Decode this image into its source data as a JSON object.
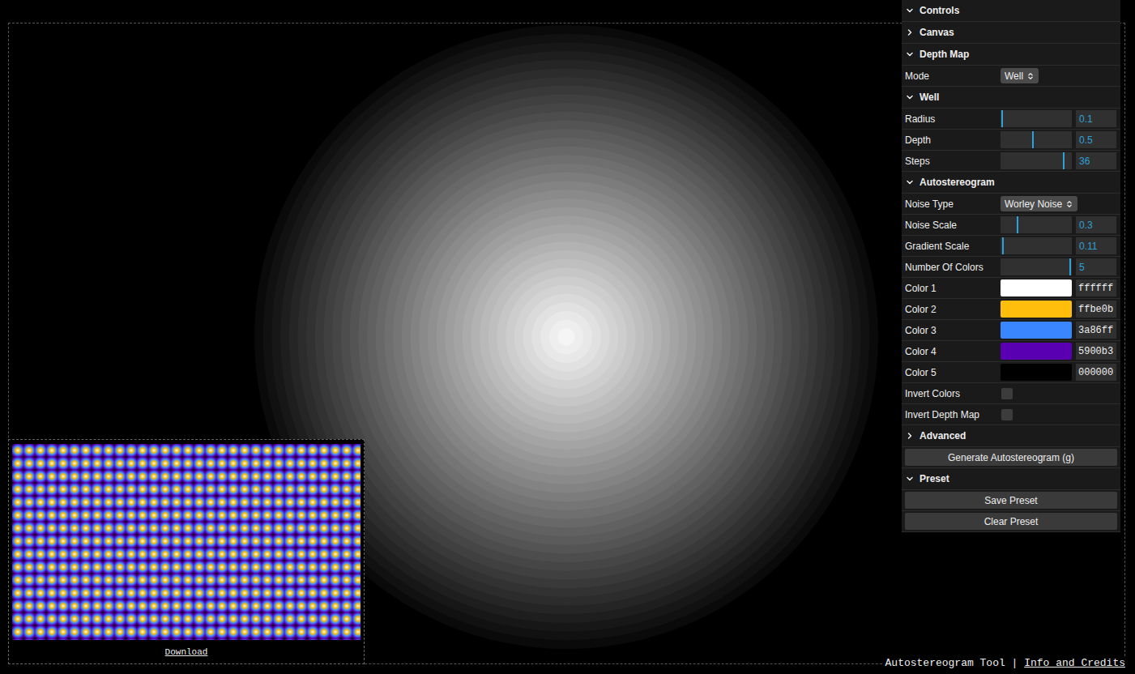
{
  "panel": {
    "title": "Controls",
    "expanded": true,
    "sections": [
      {
        "title": "Canvas",
        "expanded": false,
        "rows": []
      },
      {
        "title": "Depth Map",
        "expanded": true,
        "rows": [
          {
            "kind": "select",
            "label": "Mode",
            "value": "Well"
          }
        ]
      },
      {
        "title": "Well",
        "expanded": true,
        "rows": [
          {
            "kind": "slider",
            "label": "Radius",
            "value": "0.1",
            "level": 0.01
          },
          {
            "kind": "slider",
            "label": "Depth",
            "value": "0.5",
            "level": 0.45
          },
          {
            "kind": "slider",
            "label": "Steps",
            "value": "36",
            "level": 0.9
          }
        ]
      },
      {
        "title": "Autostereogram",
        "expanded": true,
        "rows": [
          {
            "kind": "select",
            "label": "Noise Type",
            "value": "Worley Noise"
          },
          {
            "kind": "slider",
            "label": "Noise Scale",
            "value": "0.3",
            "level": 0.23
          },
          {
            "kind": "slider",
            "label": "Gradient Scale",
            "value": "0.11",
            "level": 0.02
          },
          {
            "kind": "slider",
            "label": "Number Of Colors",
            "value": "5",
            "level": 0.99
          },
          {
            "kind": "color",
            "label": "Color 1",
            "value": "ffffff",
            "color": "#ffffff"
          },
          {
            "kind": "color",
            "label": "Color 2",
            "value": "ffbe0b",
            "color": "#ffbe0b"
          },
          {
            "kind": "color",
            "label": "Color 3",
            "value": "3a86ff",
            "color": "#3a86ff"
          },
          {
            "kind": "color",
            "label": "Color 4",
            "value": "5900b3",
            "color": "#5900b3"
          },
          {
            "kind": "color",
            "label": "Color 5",
            "value": "000000",
            "color": "#000000"
          },
          {
            "kind": "checkbox",
            "label": "Invert Colors",
            "checked": false
          },
          {
            "kind": "checkbox",
            "label": "Invert Depth Map",
            "checked": false
          },
          {
            "kind": "folder",
            "label": "Advanced",
            "expanded": false
          },
          {
            "kind": "button",
            "label": "Generate Autostereogram (g)"
          }
        ]
      },
      {
        "title": "Preset",
        "expanded": true,
        "rows": [
          {
            "kind": "button",
            "label": "Save Preset"
          },
          {
            "kind": "button",
            "label": "Clear Preset"
          }
        ]
      }
    ]
  },
  "preview": {
    "link": "Download"
  },
  "footer": {
    "title": "Autostereogram Tool | ",
    "link": "Info and Credits"
  }
}
